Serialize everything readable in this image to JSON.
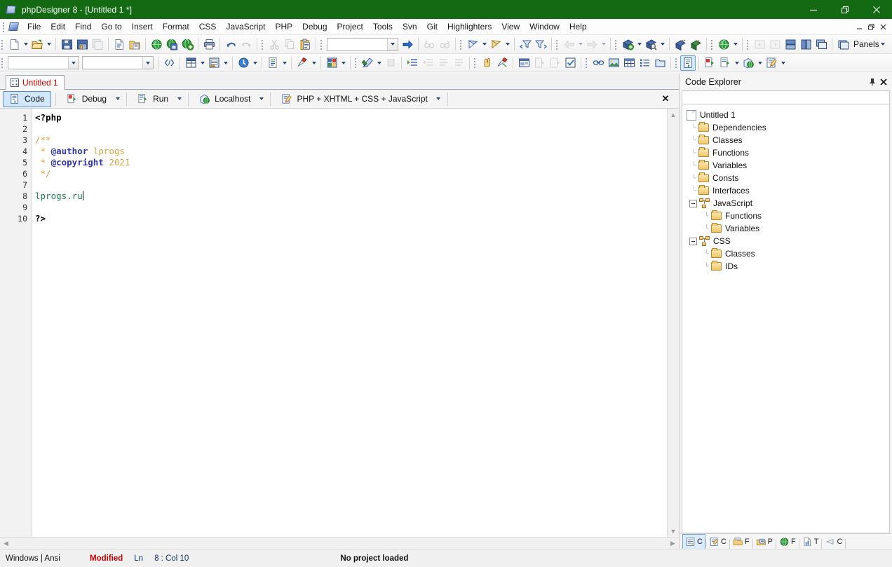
{
  "window": {
    "title": "phpDesigner 8 - [Untitled 1 *]",
    "app_icon": "phpdesigner-icon",
    "minimize": "minimize-button",
    "maximize": "maximize-button",
    "close": "close-button"
  },
  "menu": {
    "items": [
      {
        "label": "File"
      },
      {
        "label": "Edit"
      },
      {
        "label": "Find"
      },
      {
        "label": "Go to"
      },
      {
        "label": "Insert"
      },
      {
        "label": "Format"
      },
      {
        "label": "CSS"
      },
      {
        "label": "JavaScript"
      },
      {
        "label": "PHP"
      },
      {
        "label": "Debug"
      },
      {
        "label": "Project"
      },
      {
        "label": "Tools"
      },
      {
        "label": "Svn"
      },
      {
        "label": "Git"
      },
      {
        "label": "Highlighters"
      },
      {
        "label": "View"
      },
      {
        "label": "Window"
      },
      {
        "label": "Help"
      }
    ],
    "mdi_minimize": "_",
    "mdi_restore": "❐",
    "mdi_close": "✕"
  },
  "toolbar_main": {
    "search_value": "",
    "panels_label": "Panels",
    "items": [
      {
        "name": "new-file-icon",
        "tip": "New"
      },
      {
        "name": "new-file-dropdown",
        "tip": "New dropdown"
      },
      {
        "name": "open-file-icon",
        "tip": "Open"
      },
      {
        "name": "open-file-dropdown",
        "tip": "Open dropdown"
      },
      {
        "name": "save-icon",
        "tip": "Save"
      },
      {
        "name": "save-as-icon",
        "tip": "Save As"
      },
      {
        "name": "save-all-icon",
        "tip": "Save All"
      },
      {
        "name": "close-file-icon",
        "tip": "Close"
      },
      {
        "name": "close-all-files-icon",
        "tip": "Close All"
      },
      {
        "name": "open-from-ftp-icon",
        "tip": "Open from web"
      },
      {
        "name": "save-to-ftp-icon",
        "tip": "Save to web"
      },
      {
        "name": "upload-web-icon",
        "tip": "Upload"
      },
      {
        "name": "print-icon",
        "tip": "Print"
      },
      {
        "name": "undo-icon",
        "tip": "Undo"
      },
      {
        "name": "redo-icon",
        "tip": "Redo"
      },
      {
        "name": "cut-icon",
        "tip": "Cut"
      },
      {
        "name": "copy-icon",
        "tip": "Copy"
      },
      {
        "name": "paste-icon",
        "tip": "Paste"
      },
      {
        "name": "find-next-icon",
        "tip": "Find next"
      },
      {
        "name": "find-prev-icon",
        "tip": "Find previous"
      },
      {
        "name": "bookmark-toggle-icon",
        "tip": "Toggle bookmark"
      },
      {
        "name": "bookmark-goto-icon",
        "tip": "Go to bookmark"
      },
      {
        "name": "filter-prev-icon",
        "tip": "Previous"
      },
      {
        "name": "filter-next-icon",
        "tip": "Next"
      },
      {
        "name": "nav-back-icon",
        "tip": "Back"
      },
      {
        "name": "nav-forward-icon",
        "tip": "Forward"
      },
      {
        "name": "add-project-icon",
        "tip": "New project"
      },
      {
        "name": "open-project-icon",
        "tip": "Open project"
      },
      {
        "name": "project-props-icon",
        "tip": "Project properties"
      },
      {
        "name": "project-publish-icon",
        "tip": "Publish project"
      },
      {
        "name": "browser-icon",
        "tip": "Preview in browser"
      },
      {
        "name": "prev-doc-icon",
        "tip": "Previous document"
      },
      {
        "name": "next-doc-icon",
        "tip": "Next document"
      },
      {
        "name": "tile-horizontal-icon",
        "tip": "Tile horizontally"
      },
      {
        "name": "tile-vertical-icon",
        "tip": "Tile vertically"
      },
      {
        "name": "cascade-icon",
        "tip": "Cascade"
      },
      {
        "name": "panels-icon",
        "tip": "Panels"
      }
    ]
  },
  "toolbar_secondary": {
    "combo1_value": "",
    "combo2_value": "",
    "items": [
      {
        "name": "code-snippet-icon"
      },
      {
        "name": "insert-table-icon"
      },
      {
        "name": "insert-form-icon"
      },
      {
        "name": "insert-image-icon"
      },
      {
        "name": "insert-list-icon"
      },
      {
        "name": "wizard-icon"
      },
      {
        "name": "colorize-icon"
      },
      {
        "name": "run-script-icon"
      },
      {
        "name": "stop-script-icon"
      },
      {
        "name": "indent-icon"
      },
      {
        "name": "outdent-icon"
      },
      {
        "name": "comment-icon"
      },
      {
        "name": "uncomment-icon"
      },
      {
        "name": "hand-tool-icon"
      },
      {
        "name": "syntax-check-icon"
      },
      {
        "name": "preview-icon"
      },
      {
        "name": "step-into-icon"
      },
      {
        "name": "step-over-icon"
      },
      {
        "name": "validate-icon"
      },
      {
        "name": "link-icon"
      },
      {
        "name": "image-icon"
      },
      {
        "name": "table-icon"
      },
      {
        "name": "list-icon"
      },
      {
        "name": "layer-icon"
      },
      {
        "name": "code-view-icon"
      },
      {
        "name": "debug-run-icon"
      },
      {
        "name": "run-icon"
      },
      {
        "name": "localhost-icon"
      },
      {
        "name": "highlighter-icon"
      }
    ]
  },
  "document_tabs": [
    {
      "label": "Untitled 1",
      "icon": "document-icon",
      "modified": true
    }
  ],
  "editor_toolbar": {
    "buttons": [
      {
        "label": "Code",
        "icon": "code-icon",
        "selected": true,
        "dropdown": false
      },
      {
        "label": "Debug",
        "icon": "debug-icon",
        "selected": false,
        "dropdown": true
      },
      {
        "label": "Run",
        "icon": "run-icon",
        "selected": false,
        "dropdown": true
      },
      {
        "label": "Localhost",
        "icon": "globe-icon",
        "selected": false,
        "dropdown": true
      },
      {
        "label": "PHP + XHTML + CSS + JavaScript",
        "icon": "highlighter-icon",
        "selected": false,
        "dropdown": true
      }
    ],
    "close_label": "✕"
  },
  "code": {
    "line_numbers": [
      "1",
      "2",
      "3",
      "4",
      "5",
      "6",
      "7",
      "8",
      "9",
      "10"
    ],
    "lines": [
      {
        "n": 1,
        "tokens": [
          {
            "t": "<?php",
            "c": "c-kw"
          }
        ]
      },
      {
        "n": 2,
        "tokens": []
      },
      {
        "n": 3,
        "tokens": [
          {
            "t": "/**",
            "c": "c-com"
          }
        ]
      },
      {
        "n": 4,
        "tokens": [
          {
            "t": " * ",
            "c": "c-com"
          },
          {
            "t": "@author",
            "c": "c-tag"
          },
          {
            "t": " ",
            "c": "c-com"
          },
          {
            "t": "lprogs",
            "c": "c-num"
          }
        ]
      },
      {
        "n": 5,
        "tokens": [
          {
            "t": " * ",
            "c": "c-com"
          },
          {
            "t": "@copyright",
            "c": "c-tag"
          },
          {
            "t": " ",
            "c": "c-com"
          },
          {
            "t": "2021",
            "c": "c-num"
          }
        ]
      },
      {
        "n": 6,
        "tokens": [
          {
            "t": " */",
            "c": "c-com"
          }
        ]
      },
      {
        "n": 7,
        "tokens": []
      },
      {
        "n": 8,
        "tokens": [
          {
            "t": "lprogs.ru",
            "c": "c-txt",
            "caret": true
          }
        ]
      },
      {
        "n": 9,
        "tokens": []
      },
      {
        "n": 10,
        "tokens": [
          {
            "t": "?>",
            "c": "c-kw"
          }
        ]
      }
    ]
  },
  "code_explorer": {
    "title": "Code Explorer",
    "pin_icon": "pin-icon",
    "close_icon": "close-icon",
    "filter_value": "",
    "tree": [
      {
        "label": "Untitled 1",
        "level": 0,
        "icon": "document-icon",
        "expander": ""
      },
      {
        "label": "Dependencies",
        "level": 1,
        "icon": "folder-icon",
        "expander": ""
      },
      {
        "label": "Classes",
        "level": 1,
        "icon": "folder-icon",
        "expander": ""
      },
      {
        "label": "Functions",
        "level": 1,
        "icon": "folder-icon",
        "expander": ""
      },
      {
        "label": "Variables",
        "level": 1,
        "icon": "folder-icon",
        "expander": ""
      },
      {
        "label": "Consts",
        "level": 1,
        "icon": "folder-icon",
        "expander": ""
      },
      {
        "label": "Interfaces",
        "level": 1,
        "icon": "folder-icon",
        "expander": ""
      },
      {
        "label": "JavaScript",
        "level": 1,
        "icon": "script-icon",
        "expander": "collapse"
      },
      {
        "label": "Functions",
        "level": 2,
        "icon": "folder-icon",
        "expander": ""
      },
      {
        "label": "Variables",
        "level": 2,
        "icon": "folder-icon",
        "expander": ""
      },
      {
        "label": "CSS",
        "level": 1,
        "icon": "script-icon",
        "expander": "collapse"
      },
      {
        "label": "Classes",
        "level": 2,
        "icon": "folder-icon",
        "expander": ""
      },
      {
        "label": "IDs",
        "level": 2,
        "icon": "folder-icon",
        "expander": ""
      }
    ]
  },
  "panel_tabs": [
    {
      "label": "C",
      "icon": "code-explorer-icon",
      "selected": true
    },
    {
      "label": "C",
      "icon": "clipboard-icon",
      "selected": false
    },
    {
      "label": "F",
      "icon": "files-icon",
      "selected": false
    },
    {
      "label": "P",
      "icon": "projects-icon",
      "selected": false
    },
    {
      "label": "F",
      "icon": "ftp-icon",
      "selected": false
    },
    {
      "label": "T",
      "icon": "todo-icon",
      "selected": false
    },
    {
      "label": "C",
      "icon": "css-icon",
      "selected": false
    }
  ],
  "statusbar": {
    "encoding": "Windows | Ansi",
    "modified": "Modified",
    "ln_label": "Ln",
    "position": "8 : Col  10",
    "project": "No project loaded"
  },
  "colors": {
    "titlebar": "#136a12",
    "accent": "#2d4a77",
    "modified": "#cc0000",
    "tab_text": "#cc0000",
    "comment": "#d9a441",
    "string": "#1f7a50",
    "tag": "#3333aa"
  }
}
